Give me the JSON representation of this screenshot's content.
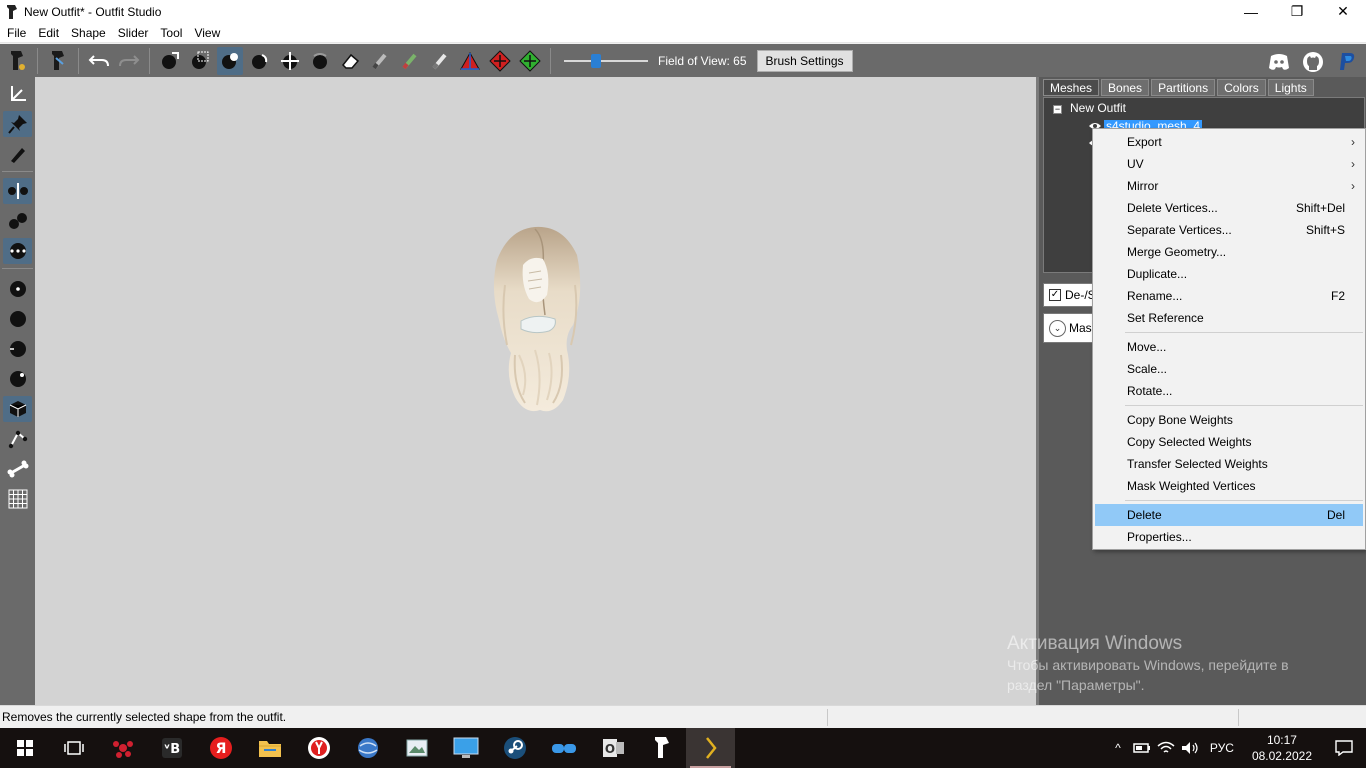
{
  "window": {
    "title": "New Outfit* - Outfit Studio",
    "minimize": "—",
    "maximize": "❐",
    "close": "✕"
  },
  "menubar": {
    "items": [
      "File",
      "Edit",
      "Shape",
      "Slider",
      "Tool",
      "View"
    ]
  },
  "toolbar": {
    "fov_label": "Field of View: 65",
    "fov_value": 65,
    "brush_settings": "Brush Settings"
  },
  "panel": {
    "tabs": [
      "Meshes",
      "Bones",
      "Partitions",
      "Colors",
      "Lights"
    ],
    "active_tab": "Meshes",
    "tree": {
      "toggle": "−",
      "root": "New Outfit",
      "selected_mesh": "s4studio_mesh_4"
    },
    "shape_row": {
      "check": "✓",
      "label": "De-/S"
    },
    "mask_row": {
      "chevron": "⌄",
      "label": "Mask"
    }
  },
  "context_menu": {
    "items": [
      {
        "label": "Export",
        "shortcut": "",
        "submenu": "›"
      },
      {
        "label": "UV",
        "shortcut": "",
        "submenu": "›"
      },
      {
        "label": "Mirror",
        "shortcut": "",
        "submenu": "›"
      },
      {
        "label": "Delete Vertices...",
        "shortcut": "Shift+Del",
        "submenu": ""
      },
      {
        "label": "Separate Vertices...",
        "shortcut": "Shift+S",
        "submenu": ""
      },
      {
        "label": "Merge Geometry...",
        "shortcut": "",
        "submenu": ""
      },
      {
        "label": "Duplicate...",
        "shortcut": "",
        "submenu": ""
      },
      {
        "label": "Rename...",
        "shortcut": "F2",
        "submenu": ""
      },
      {
        "label": "Set Reference",
        "shortcut": "",
        "submenu": ""
      },
      {
        "label": "Move...",
        "shortcut": "",
        "submenu": ""
      },
      {
        "label": "Scale...",
        "shortcut": "",
        "submenu": ""
      },
      {
        "label": "Rotate...",
        "shortcut": "",
        "submenu": ""
      },
      {
        "label": "Copy Bone Weights",
        "shortcut": "",
        "submenu": ""
      },
      {
        "label": "Copy Selected Weights",
        "shortcut": "",
        "submenu": ""
      },
      {
        "label": "Transfer Selected Weights",
        "shortcut": "",
        "submenu": ""
      },
      {
        "label": "Mask Weighted Vertices",
        "shortcut": "",
        "submenu": ""
      },
      {
        "label": "Delete",
        "shortcut": "Del",
        "submenu": ""
      },
      {
        "label": "Properties...",
        "shortcut": "",
        "submenu": ""
      }
    ],
    "highlighted": "Delete"
  },
  "watermark": {
    "title": "Активация Windows",
    "subtitle": "Чтобы активировать Windows, перейдите в раздел \"Параметры\"."
  },
  "statusbar": {
    "text": "Removes the currently selected shape from the outfit."
  },
  "taskbar": {
    "apps": [
      "start-icon",
      "task-view-icon",
      "game-icon",
      "vk-icon",
      "yandex-icon",
      "file-explorer-icon",
      "yandex-browser-icon",
      "globe-icon",
      "photos-icon",
      "monitor-icon",
      "steam-icon",
      "link-icon",
      "outlook-icon",
      "outfit-studio-icon",
      "sims-studio-icon"
    ],
    "tray_chevron": "^",
    "lang": "РУС",
    "time": "10:17",
    "date": "08.02.2022"
  },
  "colors": {
    "toolbar_bg": "#6a6a6a",
    "viewport_bg": "#d3d3d3",
    "panel_bg": "#5a5a5a",
    "active_tool": "#4f6d87",
    "selection": "#3399ff",
    "menu_highlight": "#91c9f7",
    "taskbar_bg": "#15100f"
  }
}
